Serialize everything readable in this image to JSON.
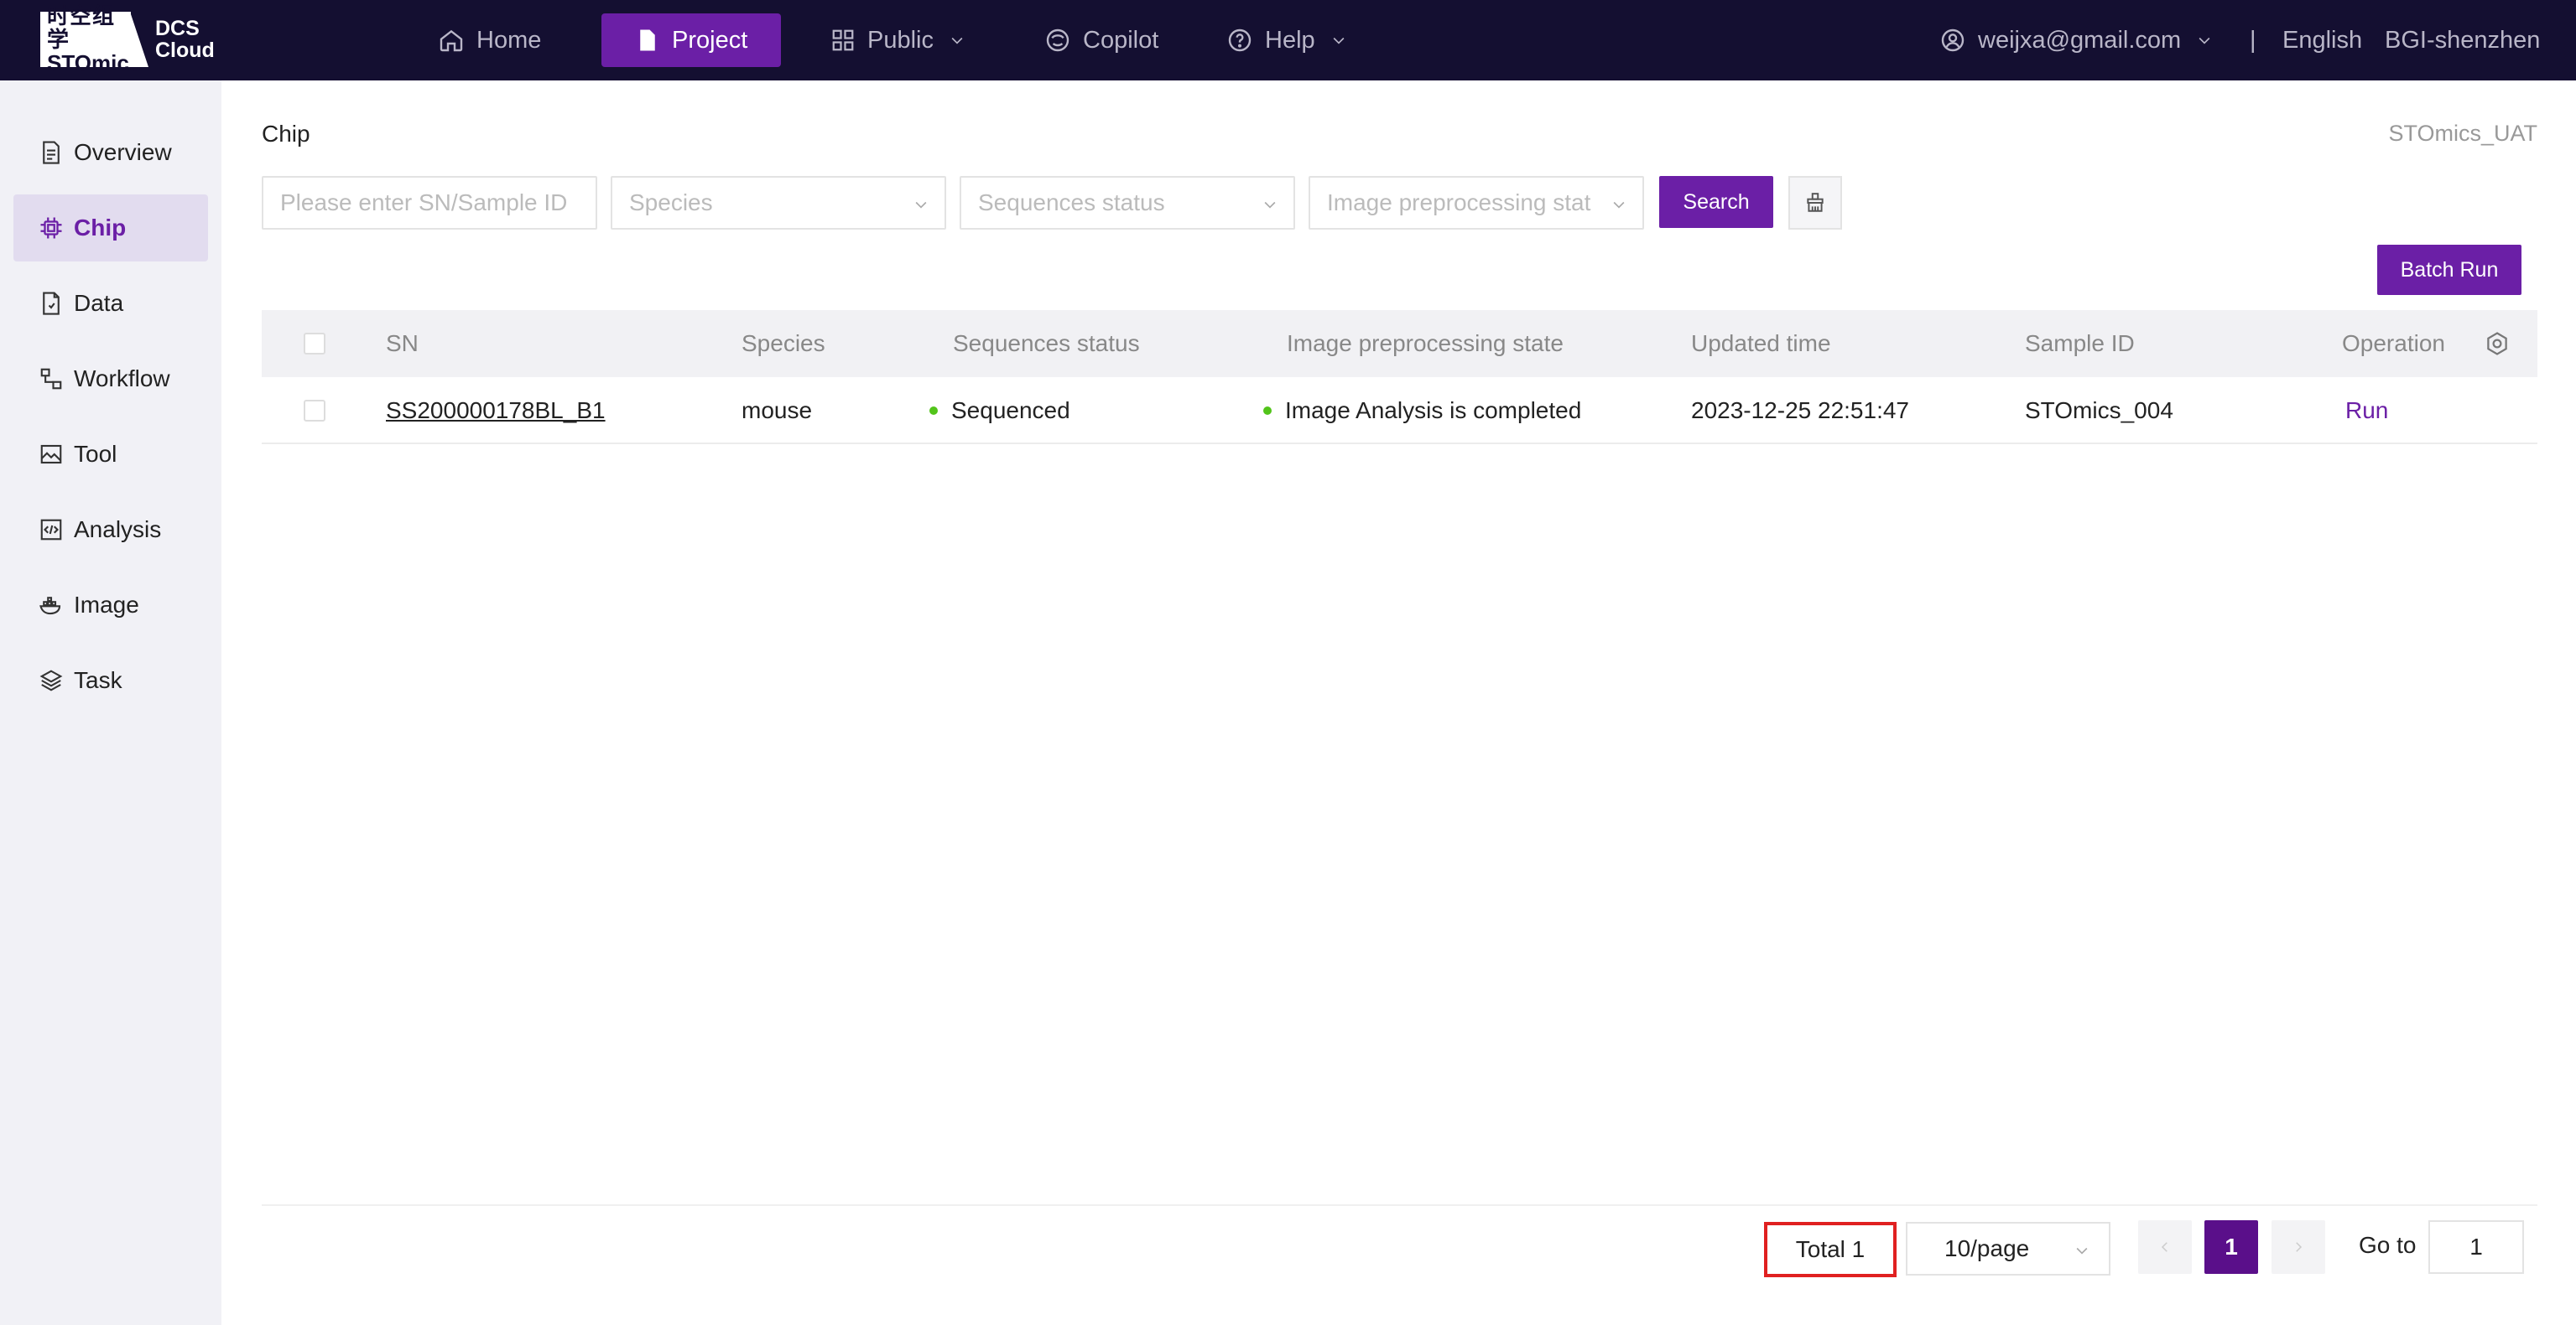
{
  "brand": {
    "logo_cn": "时空组学",
    "logo_en": "STOmics",
    "product_line1": "DCS",
    "product_line2": "Cloud"
  },
  "nav": {
    "home": "Home",
    "project": "Project",
    "public": "Public",
    "copilot": "Copilot",
    "help": "Help",
    "user": "weijxa@gmail.com",
    "divider": "|",
    "language": "English",
    "org": "BGI-shenzhen"
  },
  "sidebar": {
    "items": [
      {
        "label": "Overview",
        "icon": "document-icon"
      },
      {
        "label": "Chip",
        "icon": "chip-icon",
        "active": true
      },
      {
        "label": "Data",
        "icon": "file-data-icon"
      },
      {
        "label": "Workflow",
        "icon": "workflow-icon"
      },
      {
        "label": "Tool",
        "icon": "image-tool-icon"
      },
      {
        "label": "Analysis",
        "icon": "code-icon"
      },
      {
        "label": "Image",
        "icon": "docker-icon"
      },
      {
        "label": "Task",
        "icon": "layers-icon"
      }
    ]
  },
  "page": {
    "title": "Chip",
    "env": "STOmics_UAT"
  },
  "filters": {
    "sn_placeholder": "Please enter SN/Sample ID",
    "species_placeholder": "Species",
    "seq_status_placeholder": "Sequences status",
    "image_state_placeholder": "Image preprocessing stat",
    "search_label": "Search",
    "batch_run_label": "Batch Run"
  },
  "table": {
    "headers": {
      "sn": "SN",
      "species": "Species",
      "seq_status": "Sequences status",
      "image_state": "Image preprocessing state",
      "updated": "Updated time",
      "sample_id": "Sample ID",
      "operation": "Operation"
    },
    "rows": [
      {
        "sn": "SS200000178BL_B1",
        "species": "mouse",
        "seq_status": "Sequenced",
        "image_state": "Image Analysis is completed",
        "updated": "2023-12-25 22:51:47",
        "sample_id": "STOmics_004",
        "operation": "Run"
      }
    ]
  },
  "pagination": {
    "total": "Total 1",
    "page_size": "10/page",
    "current_page": "1",
    "goto_label": "Go to",
    "goto_value": "1"
  },
  "colors": {
    "primary": "#6b1fa6",
    "navbar": "#140f31",
    "highlight_box": "#e02020",
    "status_dot": "#52c41a"
  }
}
